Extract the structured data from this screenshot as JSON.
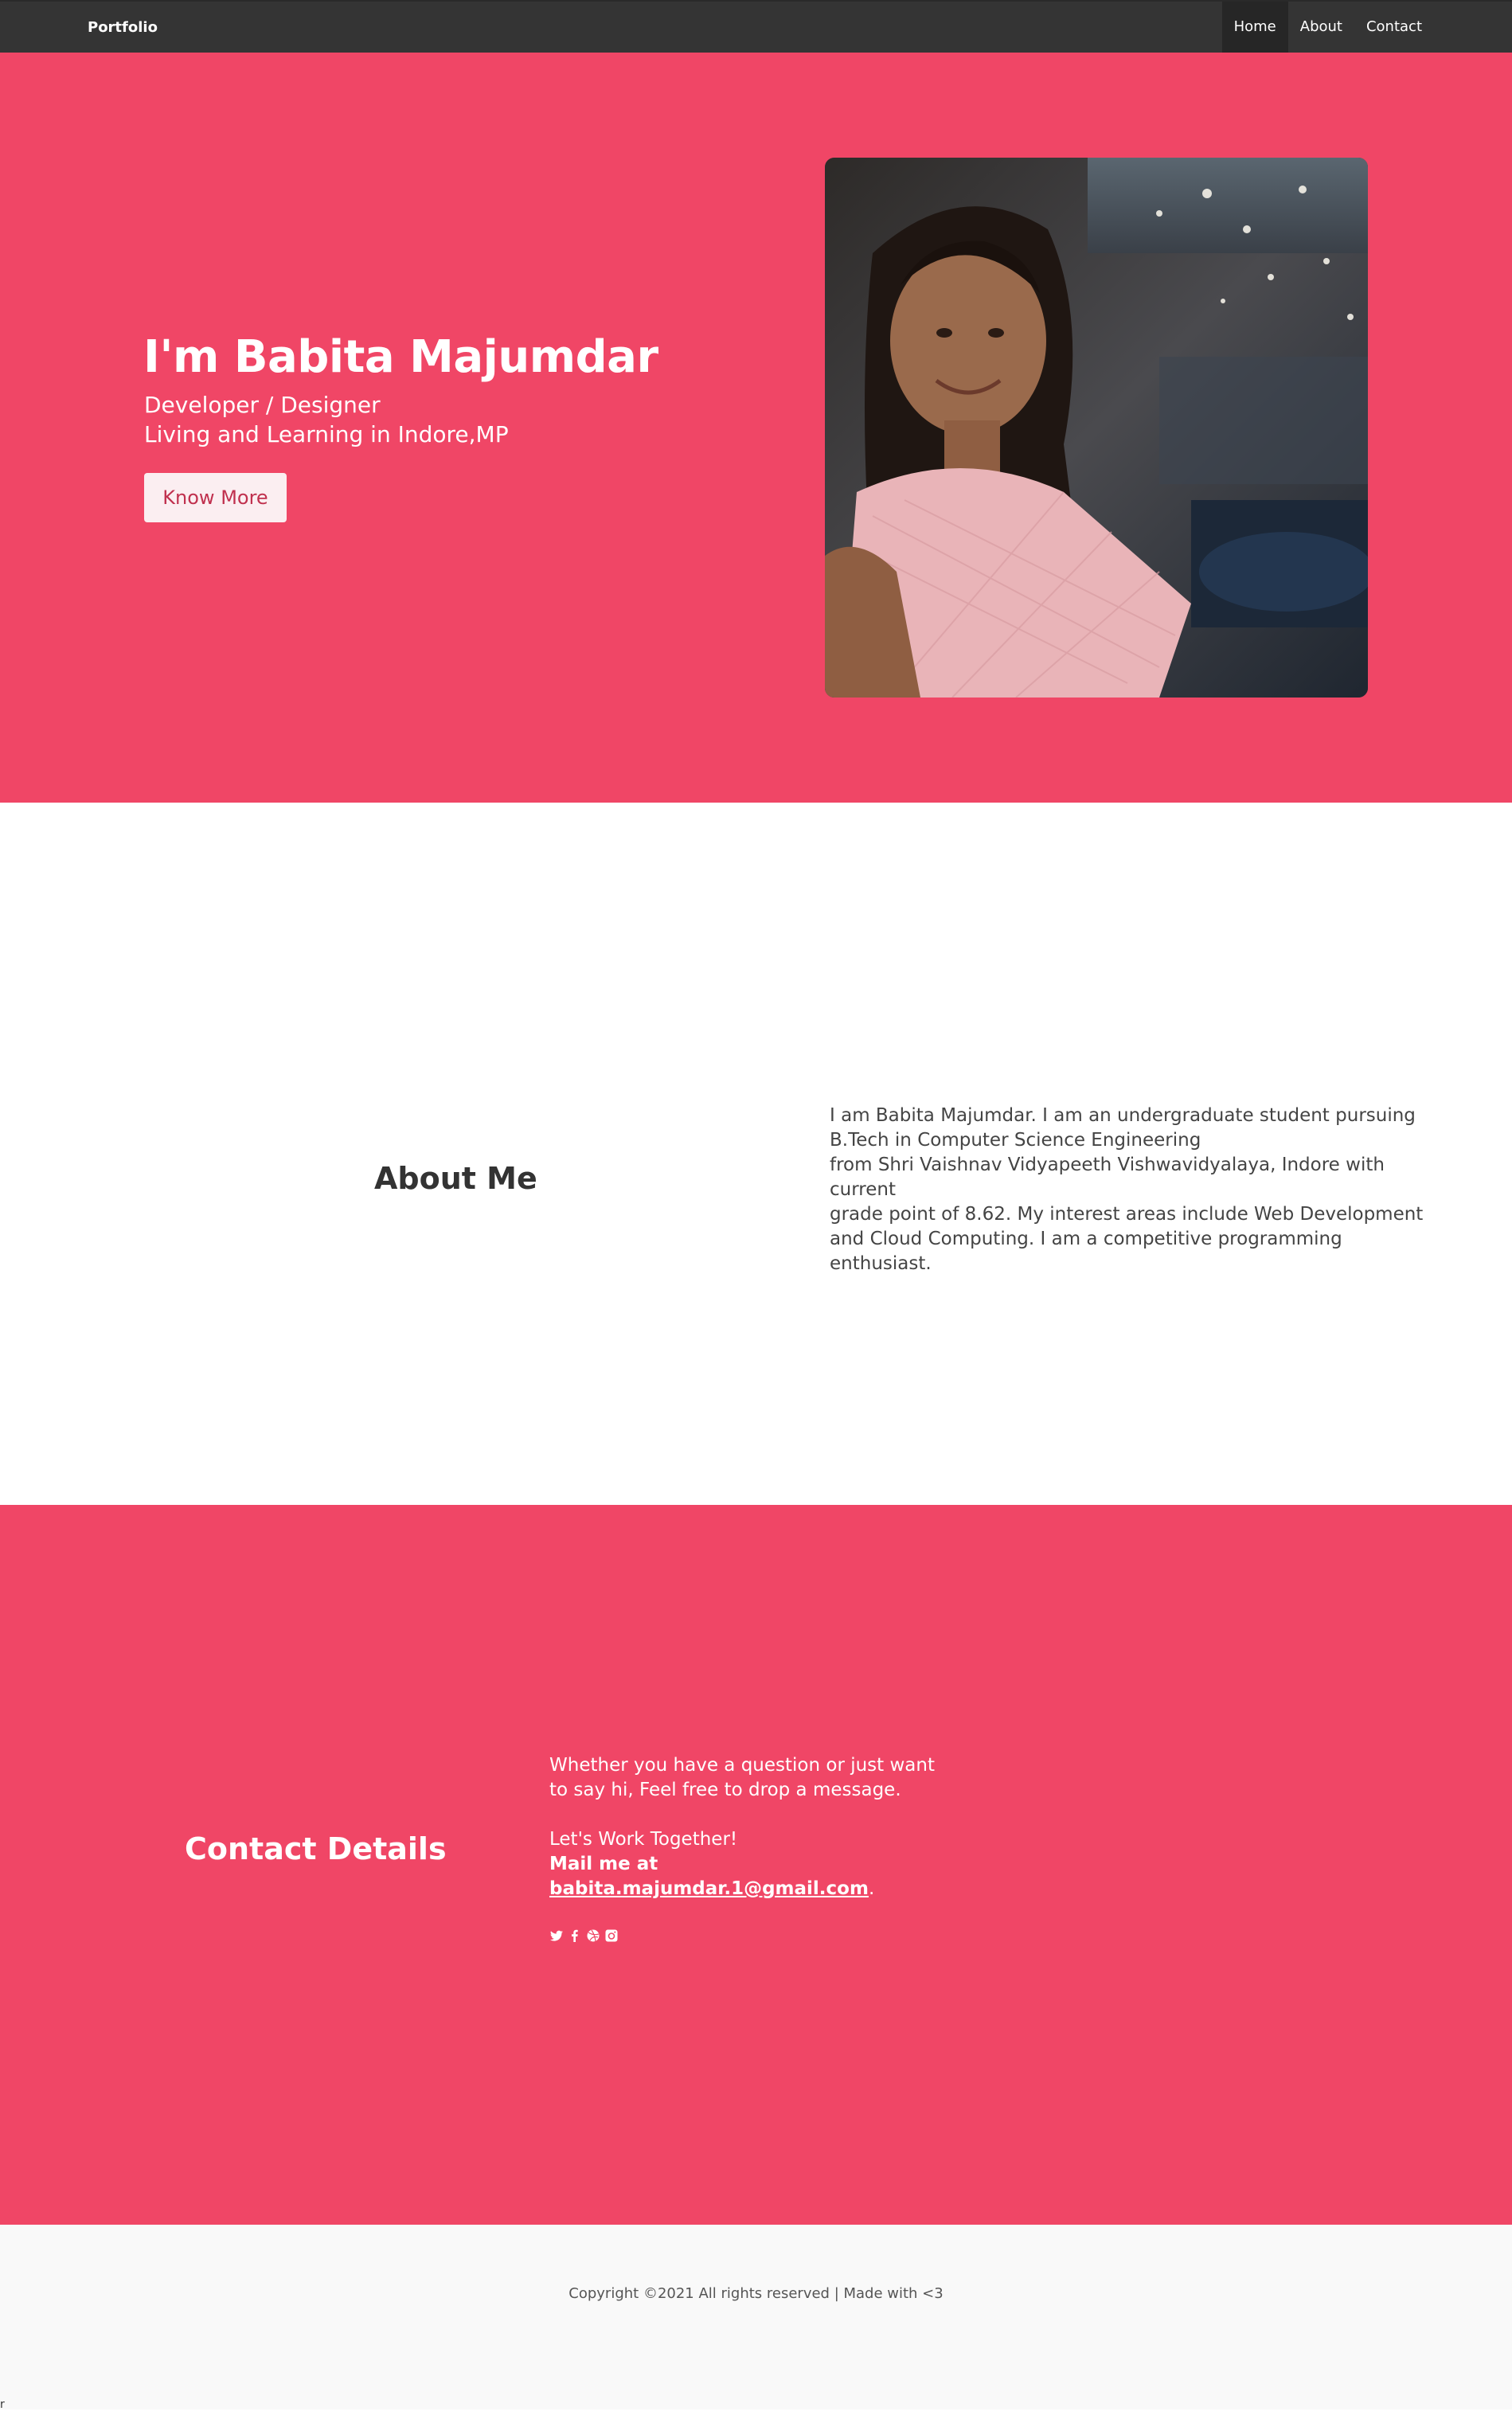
{
  "nav": {
    "brand": "Portfolio",
    "links": [
      "Home",
      "About",
      "Contact"
    ],
    "active": "Home"
  },
  "hero": {
    "title": "I'm Babita Majumdar",
    "subtitle1": "Developer / Designer",
    "subtitle2": "Living and Learning in Indore,MP",
    "button": "Know More"
  },
  "about": {
    "title": "About Me",
    "lines": [
      "I am Babita Majumdar. I am an undergraduate student pursuing",
      "B.Tech in Computer Science Engineering",
      "from Shri Vaishnav Vidyapeeth Vishwavidyalaya, Indore with current",
      "grade point of 8.62. My interest areas include Web Development",
      "and Cloud Computing. I am a competitive programming enthusiast."
    ]
  },
  "contact": {
    "title": "Contact Details",
    "line1": "Whether you have a question or just want",
    "line2": "to say hi, Feel free to drop a message.",
    "line3": "Let's Work Together!",
    "mail_label": "Mail me at",
    "email": "babita.majumdar.1@gmail.com",
    "email_suffix": ".",
    "social_icons": [
      "twitter-icon",
      "facebook-icon",
      "dribbble-icon",
      "instagram-icon"
    ]
  },
  "footer": {
    "copyright": "Copyright ©2021 All rights reserved | Made with <3"
  },
  "stray_text": "r",
  "colors": {
    "accent": "#f04666",
    "navbar": "#343434",
    "footer_bg": "#f9f9f9"
  }
}
